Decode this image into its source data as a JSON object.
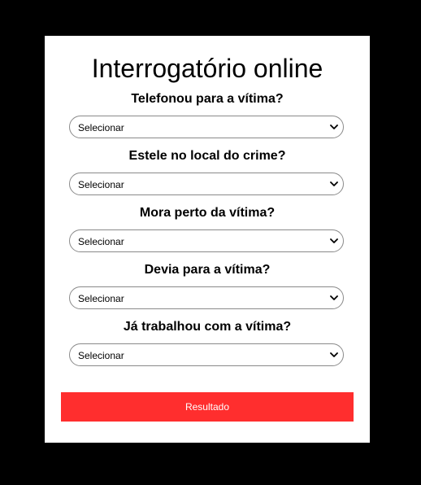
{
  "page": {
    "title": "Interrogatório online"
  },
  "questions": [
    {
      "label": "Telefonou para a vítima?",
      "selected": "Selecionar"
    },
    {
      "label": "Estele no local do crime?",
      "selected": "Selecionar"
    },
    {
      "label": "Mora perto da vítima?",
      "selected": "Selecionar"
    },
    {
      "label": "Devia para a vítima?",
      "selected": "Selecionar"
    },
    {
      "label": "Já trabalhou com a vítima?",
      "selected": "Selecionar"
    }
  ],
  "actions": {
    "result_label": "Resultado"
  },
  "colors": {
    "background": "#000000",
    "card": "#ffffff",
    "button": "#ff2e2e",
    "button_text": "#ffffff"
  },
  "icons": {
    "select_indicator": "chevron-down-icon"
  }
}
